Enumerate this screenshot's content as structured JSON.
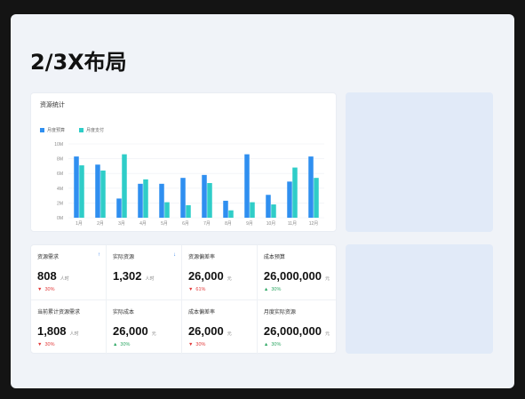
{
  "page": {
    "title": "2/3X布局"
  },
  "chart_card": {
    "title": "资源统计"
  },
  "chart_data": {
    "type": "bar",
    "title": "资源统计",
    "categories": [
      "1月",
      "2月",
      "3月",
      "4月",
      "5月",
      "6月",
      "7月",
      "8月",
      "9月",
      "10月",
      "11月",
      "12月"
    ],
    "series": [
      {
        "name": "月度预算",
        "color": "#2f8ff0",
        "values": [
          8.3,
          7.2,
          2.6,
          4.6,
          4.6,
          5.4,
          5.8,
          2.3,
          8.6,
          3.1,
          4.9,
          8.3
        ]
      },
      {
        "name": "月度支付",
        "color": "#2fcdc8",
        "values": [
          7.1,
          6.4,
          8.6,
          5.2,
          2.1,
          1.7,
          4.7,
          1.0,
          2.1,
          1.8,
          6.8,
          5.4
        ]
      }
    ],
    "yticks": [
      "0M",
      "2M",
      "4M",
      "6M",
      "8M",
      "10M"
    ],
    "ylim": [
      0,
      10
    ],
    "grid": true,
    "legend": "top-left"
  },
  "metrics": [
    {
      "label": "资源需求",
      "value": "808",
      "unit": "人时",
      "change": "30%",
      "direction": "down",
      "info_icon": "↑"
    },
    {
      "label": "实际资源",
      "value": "1,302",
      "unit": "人时",
      "change": "",
      "direction": "",
      "info_icon": "↓"
    },
    {
      "label": "资源偏差率",
      "value": "26,000",
      "unit": "元",
      "change": "61%",
      "direction": "down",
      "info_icon": ""
    },
    {
      "label": "成本预算",
      "value": "26,000,000",
      "unit": "元",
      "change": "30%",
      "direction": "up",
      "info_icon": ""
    },
    {
      "label": "当前累计资源需求",
      "value": "1,808",
      "unit": "人时",
      "change": "30%",
      "direction": "down",
      "info_icon": ""
    },
    {
      "label": "实际成本",
      "value": "26,000",
      "unit": "元",
      "change": "30%",
      "direction": "up",
      "info_icon": ""
    },
    {
      "label": "成本偏差率",
      "value": "26,000",
      "unit": "元",
      "change": "30%",
      "direction": "down",
      "info_icon": ""
    },
    {
      "label": "月度实际资源",
      "value": "26,000,000",
      "unit": "元",
      "change": "30%",
      "direction": "up",
      "info_icon": ""
    }
  ]
}
